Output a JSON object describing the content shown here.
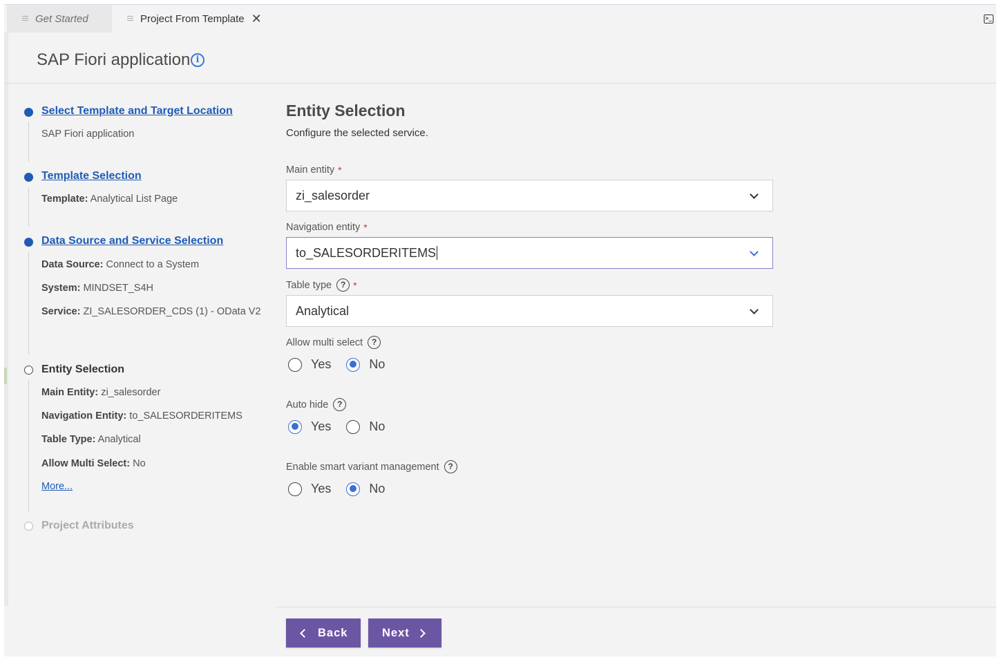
{
  "tabs": [
    {
      "label": "Get Started",
      "active": false
    },
    {
      "label": "Project From Template",
      "active": true
    }
  ],
  "tab_close_glyph": "✕",
  "header": {
    "title": "SAP Fiori application"
  },
  "steps": {
    "s1": {
      "title": "Select Template and Target Location",
      "detail": "SAP Fiori application"
    },
    "s2": {
      "title": "Template Selection",
      "template_label": "Template:",
      "template_value": "Analytical List Page"
    },
    "s3": {
      "title": "Data Source and Service Selection",
      "ds_label": "Data Source:",
      "ds_value": "Connect to a System",
      "sys_label": "System:",
      "sys_value": "MINDSET_S4H",
      "svc_label": "Service:",
      "svc_value": "ZI_SALESORDER_CDS (1) - OData V2"
    },
    "s4": {
      "title": "Entity Selection",
      "me_label": "Main Entity:",
      "me_value": "zi_salesorder",
      "ne_label": "Navigation Entity:",
      "ne_value": "to_SALESORDERITEMS",
      "tt_label": "Table Type:",
      "tt_value": "Analytical",
      "ams_label": "Allow Multi Select:",
      "ams_value": "No",
      "more": "More..."
    },
    "s5": {
      "title": "Project Attributes"
    }
  },
  "form": {
    "title": "Entity Selection",
    "subtitle": "Configure the selected service.",
    "main_entity": {
      "label": "Main entity",
      "value": "zi_salesorder"
    },
    "navigation_entity": {
      "label": "Navigation entity",
      "value": "to_SALESORDERITEMS"
    },
    "table_type": {
      "label": "Table type",
      "value": "Analytical"
    },
    "allow_multi_select": {
      "label": "Allow multi select",
      "selected": "No"
    },
    "auto_hide": {
      "label": "Auto hide",
      "selected": "Yes"
    },
    "smart_variant": {
      "label": "Enable smart variant management",
      "selected": "No"
    },
    "yes": "Yes",
    "no": "No",
    "required_mark": "*",
    "help_glyph": "?"
  },
  "footer": {
    "back": "Back",
    "next": "Next"
  },
  "colors": {
    "accent": "#6b56a3",
    "link": "#1f5bb5",
    "radio": "#3a6fd5",
    "required": "#d32f2f"
  }
}
